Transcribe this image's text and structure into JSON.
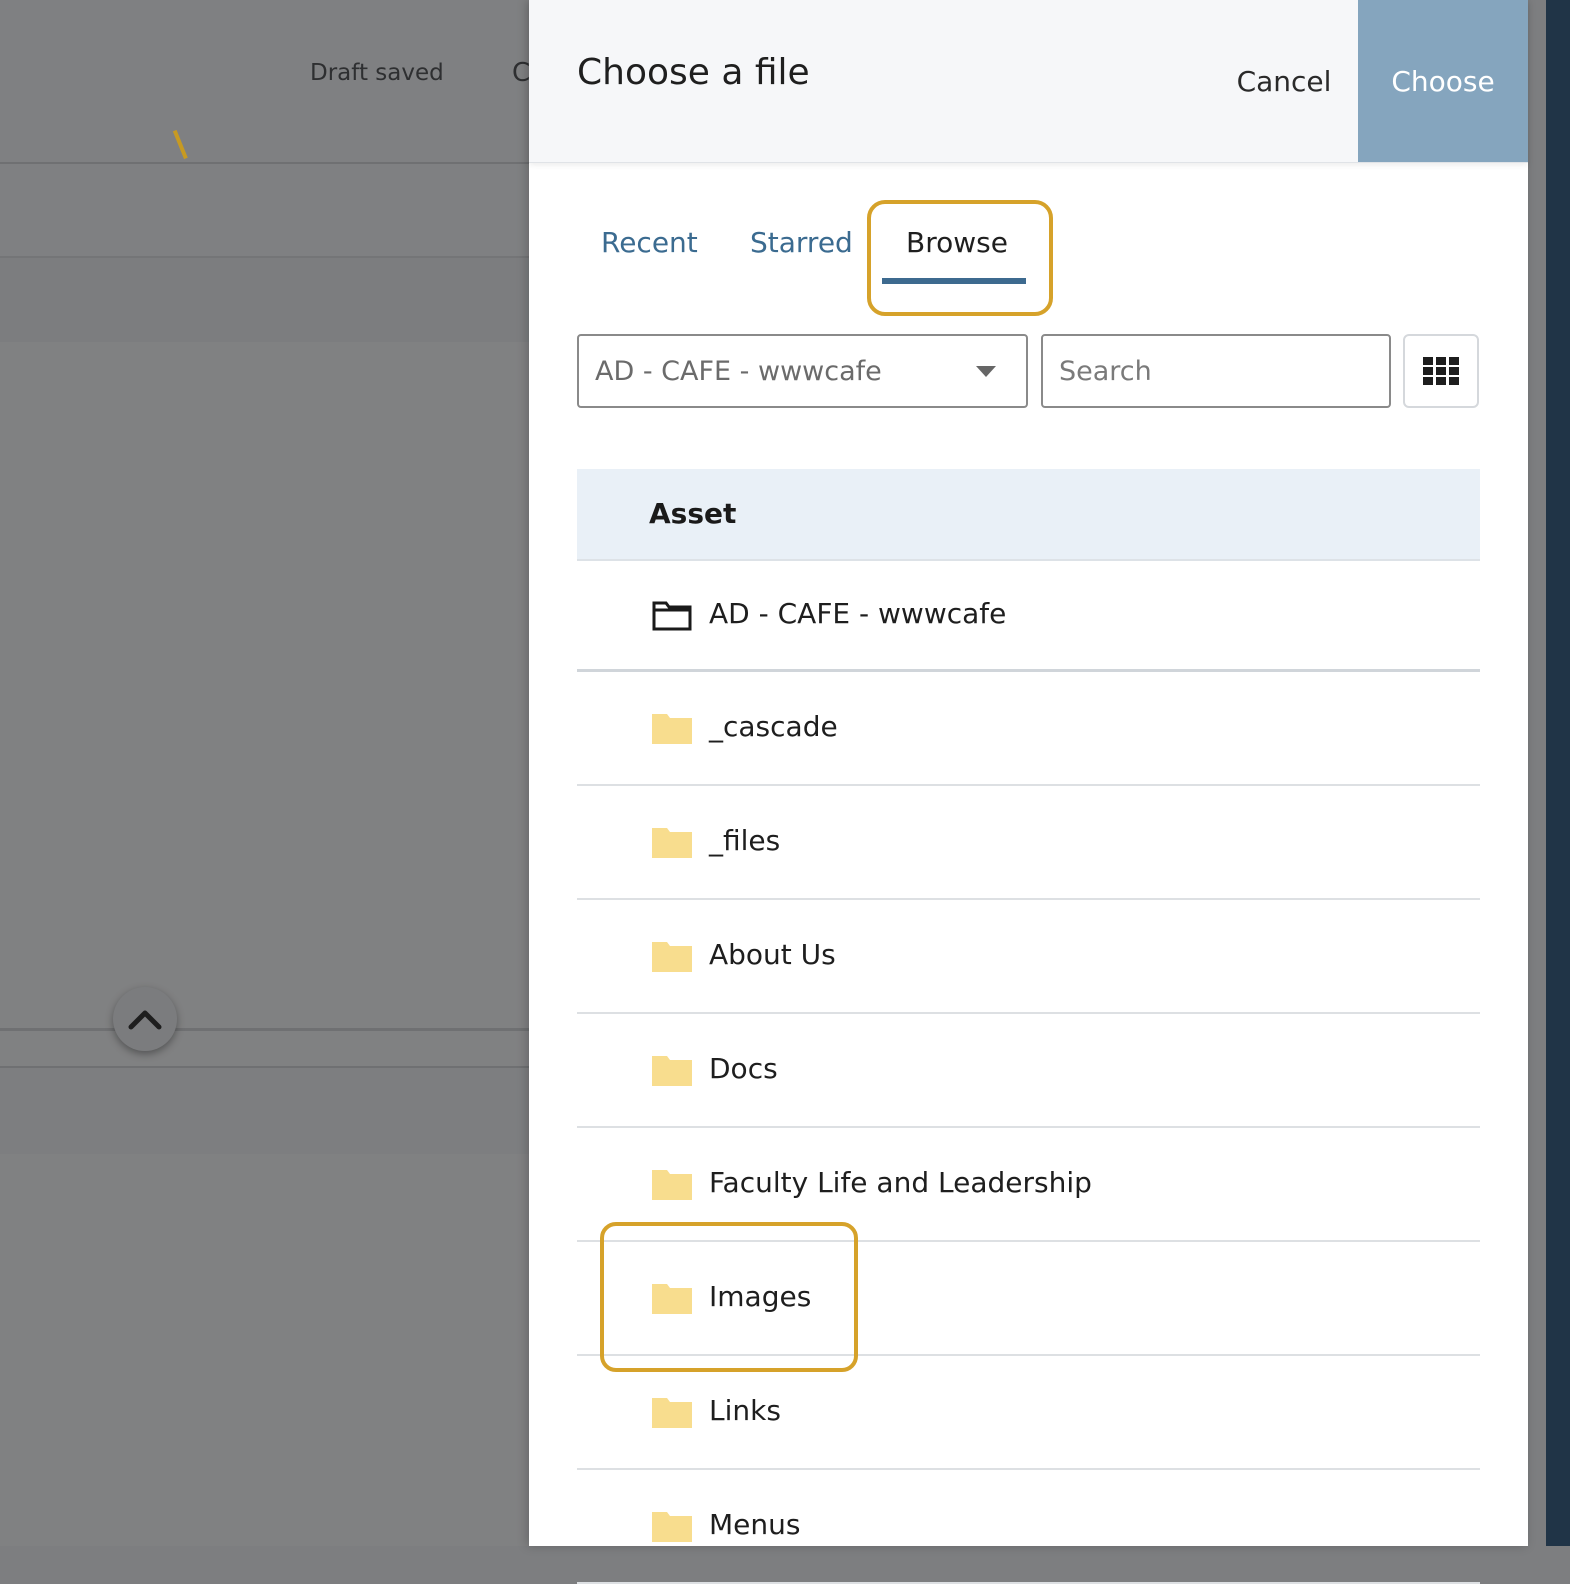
{
  "background": {
    "draft_status": "Draft saved",
    "cut_letter": "C"
  },
  "modal": {
    "title": "Choose a file",
    "cancel_label": "Cancel",
    "choose_label": "Choose",
    "tabs": [
      {
        "label": "Recent"
      },
      {
        "label": "Starred"
      },
      {
        "label": "Browse",
        "active": true
      }
    ],
    "site_select": {
      "value": "AD - CAFE - wwwcafe"
    },
    "search": {
      "placeholder": "Search"
    },
    "table": {
      "header": "Asset",
      "root": {
        "label": "AD - CAFE - wwwcafe",
        "icon": "folder-outline-icon"
      },
      "rows": [
        {
          "label": "_cascade",
          "icon": "folder-icon"
        },
        {
          "label": "_files",
          "icon": "folder-icon"
        },
        {
          "label": "About Us",
          "icon": "folder-icon"
        },
        {
          "label": "Docs",
          "icon": "folder-icon"
        },
        {
          "label": "Faculty Life and Leadership",
          "icon": "folder-icon"
        },
        {
          "label": "Images",
          "icon": "folder-icon",
          "highlighted": true
        },
        {
          "label": "Links",
          "icon": "folder-icon"
        },
        {
          "label": "Menus",
          "icon": "folder-icon"
        }
      ]
    }
  },
  "colors": {
    "accent": "#3d6a8f",
    "choose_button": "#85a5be",
    "highlight": "#d6a22a",
    "folder": "#f8dd8e",
    "table_header": "#e9f0f7"
  }
}
